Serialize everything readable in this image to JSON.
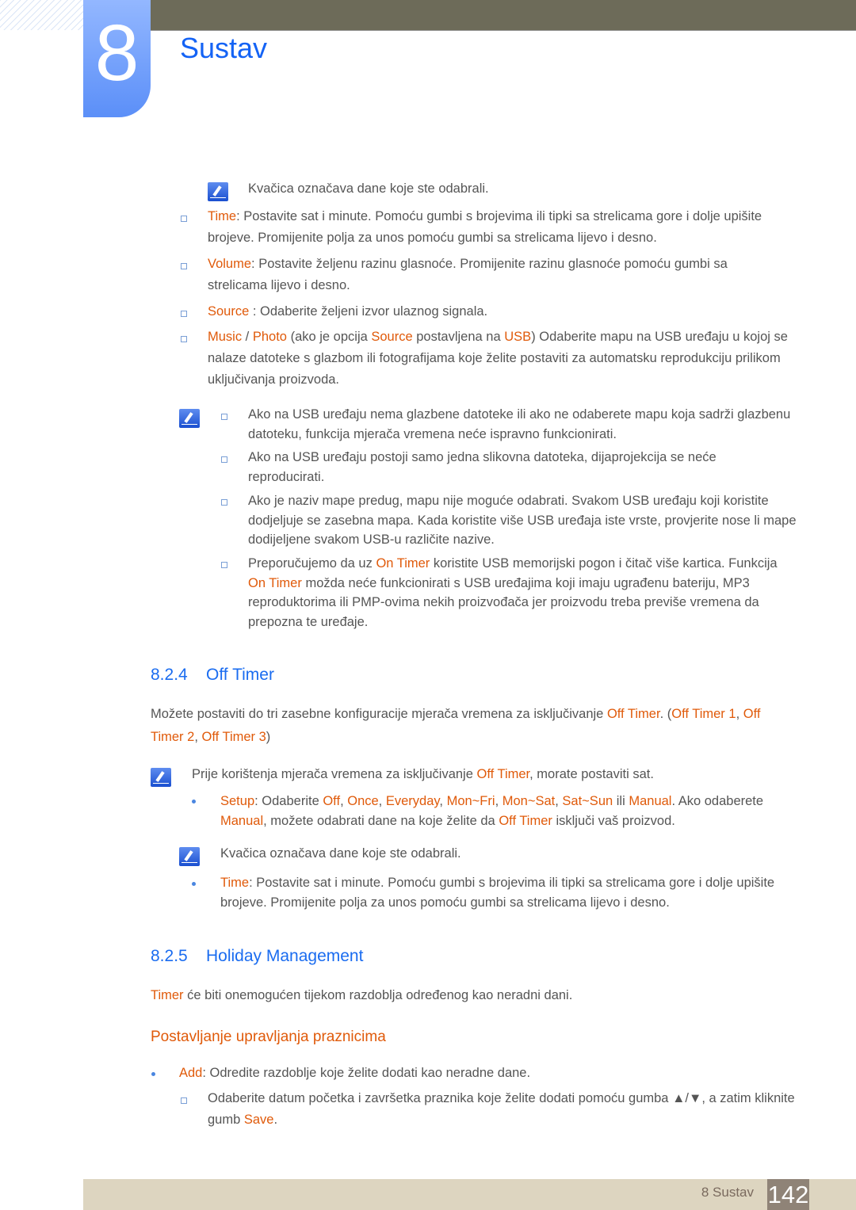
{
  "header": {
    "chapter_number": "8",
    "chapter_title": "Sustav"
  },
  "blocks": [
    {
      "id": "p1",
      "seg": [
        [
          "Kvačica označava dane koje ste odabrali.",
          0
        ]
      ]
    },
    {
      "id": "p2",
      "seg": [
        [
          "Time",
          1
        ],
        [
          ": Postavite sat i minute. Pomoću gumbi s brojevima ili tipki sa strelicama gore i dolje upišite brojeve. Promijenite polja za unos pomoću gumbi sa strelicama lijevo i desno.",
          0
        ]
      ]
    },
    {
      "id": "p3",
      "seg": [
        [
          "Volume",
          1
        ],
        [
          ": Postavite željenu razinu glasnoće. Promijenite razinu glasnoće pomoću gumbi sa strelicama lijevo i desno.",
          0
        ]
      ]
    },
    {
      "id": "p4",
      "seg": [
        [
          "Source",
          1
        ],
        [
          " : Odaberite željeni izvor ulaznog signala.",
          0
        ]
      ]
    },
    {
      "id": "p5",
      "seg": [
        [
          "Music",
          1
        ],
        [
          " / ",
          0
        ],
        [
          "Photo",
          1
        ],
        [
          " (ako je opcija ",
          0
        ],
        [
          "Source",
          1
        ],
        [
          " postavljena na ",
          0
        ],
        [
          "USB",
          1
        ],
        [
          ") Odaberite mapu na USB uređaju u kojoj se nalaze datoteke s glazbom ili fotografijama koje želite postaviti za automatsku reprodukciju prilikom uključivanja proizvoda.",
          0
        ]
      ]
    },
    {
      "id": "n1",
      "seg": [
        [
          "Ako na USB uređaju nema glazbene datoteke ili ako ne odaberete mapu koja sadrži glazbenu datoteku, funkcija mjerača vremena neće ispravno funkcionirati.",
          0
        ]
      ]
    },
    {
      "id": "n2",
      "seg": [
        [
          "Ako na USB uređaju postoji samo jedna slikovna datoteka, dijaprojekcija se neće reproducirati.",
          0
        ]
      ]
    },
    {
      "id": "n3",
      "seg": [
        [
          "Ako je naziv mape predug, mapu nije moguće odabrati. Svakom USB uređaju koji koristite dodjeljuje se zasebna mapa. Kada koristite više USB uređaja iste vrste, provjerite nose li mape dodijeljene svakom USB-u različite nazive.",
          0
        ]
      ]
    },
    {
      "id": "n4",
      "seg": [
        [
          "Preporučujemo da uz ",
          0
        ],
        [
          "On Timer",
          1
        ],
        [
          " koristite USB memorijski pogon i čitač više kartica. Funkcija ",
          0
        ],
        [
          "On Timer",
          1
        ],
        [
          " možda neće funkcionirati s USB uređajima koji imaju ugrađenu bateriju, MP3 reproduktorima ili PMP-ovima nekih proizvođača jer proizvodu treba previše vremena da prepozna te uređaje.",
          0
        ]
      ]
    },
    {
      "id": "q1",
      "seg": [
        [
          "Možete postaviti do tri zasebne konfiguracije mjerača vremena za isključivanje ",
          0
        ],
        [
          "Off Timer",
          1
        ],
        [
          ". (",
          0
        ],
        [
          "Off Timer 1",
          1
        ],
        [
          ", ",
          0
        ],
        [
          "Off Timer 2",
          1
        ],
        [
          ", ",
          0
        ],
        [
          "Off Timer 3",
          1
        ],
        [
          ")",
          0
        ]
      ]
    },
    {
      "id": "q2",
      "seg": [
        [
          "Prije korištenja mjerača vremena za isključivanje ",
          0
        ],
        [
          "Off Timer",
          1
        ],
        [
          ", morate postaviti sat.",
          0
        ]
      ]
    },
    {
      "id": "q3",
      "seg": [
        [
          "Setup",
          1
        ],
        [
          ": Odaberite ",
          0
        ],
        [
          "Off",
          1
        ],
        [
          ", ",
          0
        ],
        [
          "Once",
          1
        ],
        [
          ", ",
          0
        ],
        [
          "Everyday",
          1
        ],
        [
          ", ",
          0
        ],
        [
          "Mon~Fri",
          1
        ],
        [
          ", ",
          0
        ],
        [
          "Mon~Sat",
          1
        ],
        [
          ", ",
          0
        ],
        [
          "Sat~Sun",
          1
        ],
        [
          " ili ",
          0
        ],
        [
          "Manual",
          1
        ],
        [
          ". Ako odaberete ",
          0
        ],
        [
          "Manual",
          1
        ],
        [
          ", možete odabrati dane na koje želite da ",
          0
        ],
        [
          "Off Timer",
          1
        ],
        [
          " isključi vaš proizvod.",
          0
        ]
      ]
    },
    {
      "id": "q4",
      "seg": [
        [
          "Kvačica označava dane koje ste odabrali.",
          0
        ]
      ]
    },
    {
      "id": "q5",
      "seg": [
        [
          "Time",
          1
        ],
        [
          ": Postavite sat i minute. Pomoću gumbi s brojevima ili tipki sa strelicama gore i dolje upišite brojeve. Promijenite polja za unos pomoću gumbi sa strelicama lijevo i desno.",
          0
        ]
      ]
    },
    {
      "id": "r1",
      "seg": [
        [
          "Timer",
          1
        ],
        [
          " će biti onemogućen tijekom razdoblja određenog kao neradni dani.",
          0
        ]
      ]
    },
    {
      "id": "r2",
      "seg": [
        [
          "Add",
          1
        ],
        [
          ": Odredite razdoblje koje želite dodati kao neradne dane.",
          0
        ]
      ]
    },
    {
      "id": "r3",
      "seg": [
        [
          "Odaberite datum početka i završetka praznika koje želite dodati pomoću gumba ▲/▼, a zatim kliknite gumb ",
          0
        ],
        [
          "Save",
          1
        ],
        [
          ".",
          0
        ]
      ]
    }
  ],
  "sections": {
    "s824": {
      "number": "8.2.4",
      "title": "Off Timer"
    },
    "s825": {
      "number": "8.2.5",
      "title": "Holiday Management"
    },
    "sub": "Postavljanje upravljanja praznicima"
  },
  "footer": {
    "label": "8 Sustav",
    "page": "142"
  },
  "colors": {
    "highlight": "#e05a0a",
    "heading": "#1a6cf0"
  }
}
